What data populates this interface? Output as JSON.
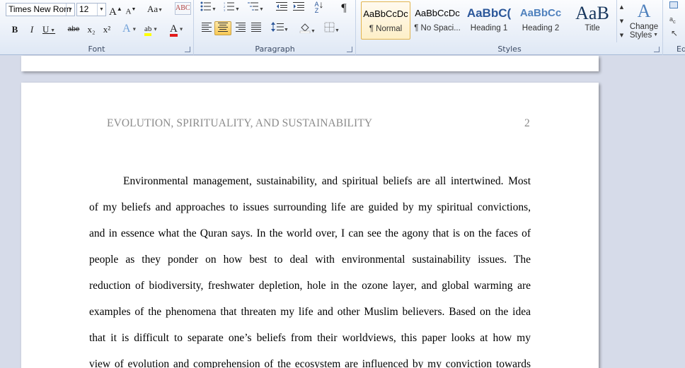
{
  "ribbon": {
    "font": {
      "group_label": "Font",
      "font_name": "Times New Rom",
      "font_size": "12",
      "grow_label": "A",
      "shrink_label": "A",
      "change_case_label": "Aa",
      "clear_format_label": "ABC",
      "bold_label": "B",
      "italic_label": "I",
      "underline_label": "U",
      "strike_label": "abe",
      "subscript_label": "x₂",
      "superscript_label": "x²",
      "effects_label": "A",
      "highlight_label": "ab",
      "font_color_label": "A"
    },
    "paragraph": {
      "group_label": "Paragraph",
      "show_marks_label": "¶"
    },
    "styles": {
      "group_label": "Styles",
      "tiles": [
        {
          "sample": "AaBbCcDc",
          "name": "¶ Normal"
        },
        {
          "sample": "AaBbCcDc",
          "name": "¶ No Spaci..."
        },
        {
          "sample": "AaBbC(",
          "name": "Heading 1"
        },
        {
          "sample": "AaBbCc",
          "name": "Heading 2"
        },
        {
          "sample": "AaB",
          "name": "Title"
        }
      ],
      "change_styles_line1": "Change",
      "change_styles_line2": "Styles",
      "change_styles_icon": "A"
    },
    "editing": {
      "group_label": "Ed"
    },
    "colors": {
      "accent_blue": "#2b579a",
      "highlight_yellow": "#ffff00",
      "font_color_red": "#e21b1b"
    }
  },
  "document": {
    "running_head": "EVOLUTION, SPIRITUALITY, AND SUSTAINABILITY",
    "page_number": "2",
    "lines": [
      "Environmental management, sustainability, and spiritual beliefs are all intertwined. Most",
      "of my beliefs and approaches to issues surrounding life are guided by my spiritual convictions,",
      "and in essence what the Quran says. In the world over, I can see the agony that is on the faces of",
      "people as they ponder on how best to deal with environmental sustainability issues. The",
      "reduction of biodiversity, freshwater depletion, hole in the ozone layer, and global warming are",
      "examples of the phenomena that threaten my life and other Muslim believers. Based on the idea",
      "that it is difficult to separate one’s beliefs from their worldviews, this paper looks at how my",
      "view of evolution and comprehension of the ecosystem are influenced by my conviction towards"
    ]
  }
}
